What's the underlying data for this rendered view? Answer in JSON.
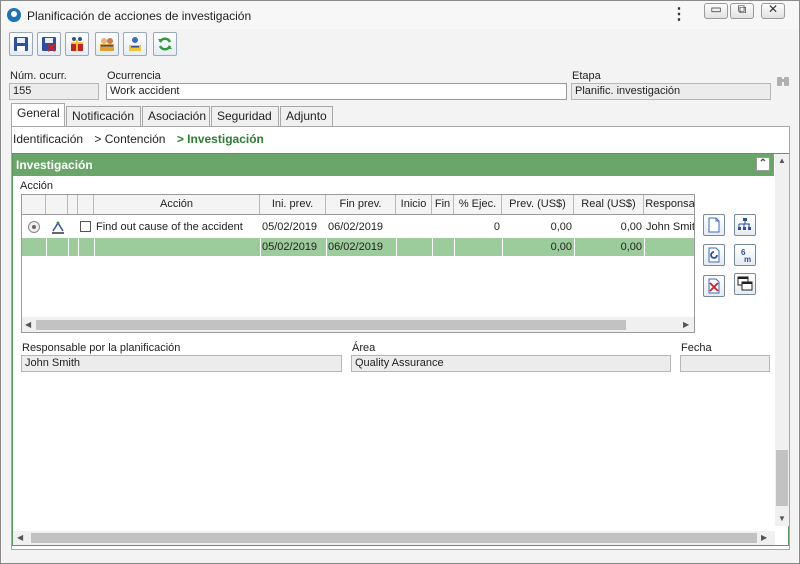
{
  "window": {
    "title": "Planificación de acciones de investigación"
  },
  "header": {
    "num_label": "Núm. ocurr.",
    "num_value": "155",
    "occurrence_label": "Ocurrencia",
    "occurrence_value": "Work accident",
    "stage_label": "Etapa",
    "stage_value": "Planific. investigación"
  },
  "tabs": [
    "General",
    "Notificación",
    "Asociación",
    "Seguridad",
    "Adjunto"
  ],
  "breadcrumb": {
    "step1": "Identificación",
    "sep": ">",
    "step2": "Contención",
    "step3": "Investigación"
  },
  "section": {
    "title": "Investigación"
  },
  "actions": {
    "label": "Acción",
    "columns": [
      "Acción",
      "Ini. prev.",
      "Fin prev.",
      "Inicio",
      "Fin",
      "% Ejec.",
      "Prev. (US$)",
      "Real (US$)",
      "Responsa"
    ],
    "rows": [
      {
        "action": "Find out cause of the accident",
        "ini_prev": "05/02/2019",
        "fin_prev": "06/02/2019",
        "inicio": "",
        "fin": "",
        "pct": "0",
        "prev": "0,00",
        "real": "0,00",
        "responsible": "John Smith"
      }
    ],
    "totals": {
      "ini_prev": "05/02/2019",
      "fin_prev": "06/02/2019",
      "prev": "0,00",
      "real": "0,00"
    }
  },
  "planning": {
    "responsible_label": "Responsable por la planificación",
    "responsible_value": "John Smith",
    "area_label": "Área",
    "area_value": "Quality Assurance",
    "date_label": "Fecha",
    "date_value": ""
  },
  "colors": {
    "accent_green": "#6aa56a",
    "row_green": "#9ccb9c",
    "breadcrumb_active": "#2e7d32"
  }
}
